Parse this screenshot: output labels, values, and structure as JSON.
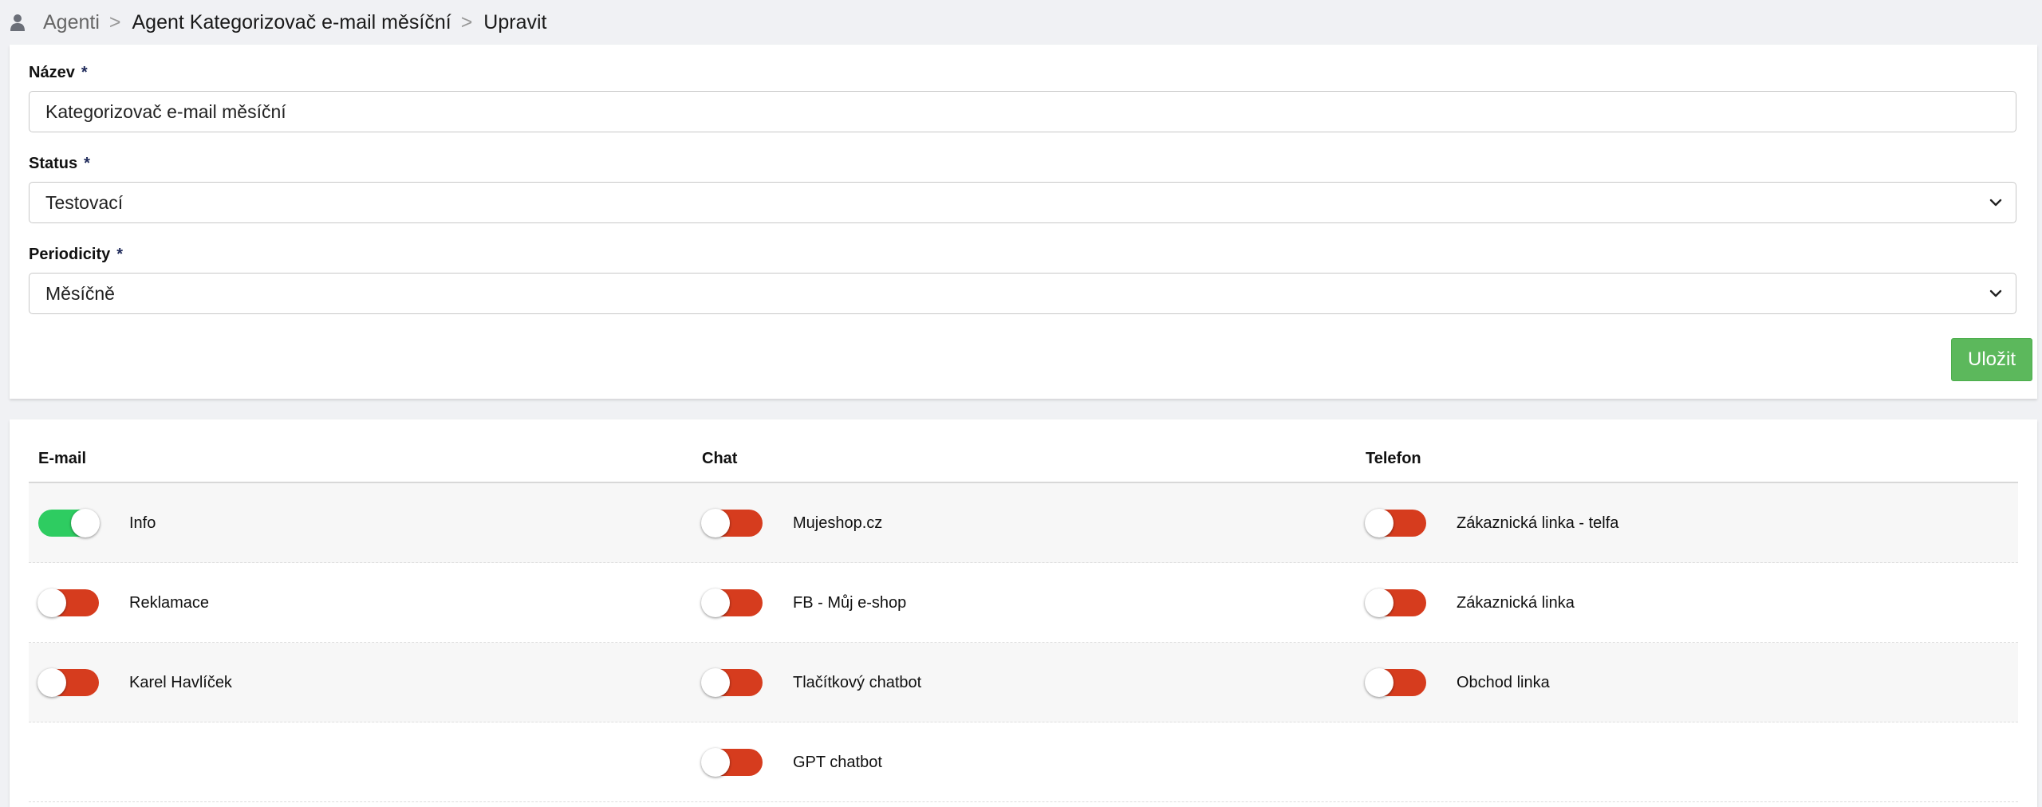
{
  "breadcrumb": {
    "items": [
      "Agenti",
      "Agent Kategorizovač e-mail měsíční",
      "Upravit"
    ],
    "separator": ">"
  },
  "form": {
    "name_label": "Název",
    "name_value": "Kategorizovač e-mail měsíční",
    "status_label": "Status",
    "status_value": "Testovací",
    "periodicity_label": "Periodicity",
    "periodicity_value": "Měsíčně",
    "required_mark": "*",
    "save_label": "Uložit"
  },
  "channels": {
    "columns": [
      {
        "header": "E-mail",
        "items": [
          {
            "label": "Info",
            "enabled": true
          },
          {
            "label": "Reklamace",
            "enabled": false
          },
          {
            "label": "Karel Havlíček",
            "enabled": false
          }
        ]
      },
      {
        "header": "Chat",
        "items": [
          {
            "label": "Mujeshop.cz",
            "enabled": false
          },
          {
            "label": "FB - Můj e-shop",
            "enabled": false
          },
          {
            "label": "Tlačítkový chatbot",
            "enabled": false
          },
          {
            "label": "GPT chatbot",
            "enabled": false
          }
        ]
      },
      {
        "header": "Telefon",
        "items": [
          {
            "label": "Zákaznická linka - telfa",
            "enabled": false
          },
          {
            "label": "Zákaznická linka",
            "enabled": false
          },
          {
            "label": "Obchod linka",
            "enabled": false
          }
        ]
      }
    ]
  },
  "colors": {
    "toggle_on": "#2ecc61",
    "toggle_off": "#d63c1e",
    "save_button": "#5cb85c"
  }
}
